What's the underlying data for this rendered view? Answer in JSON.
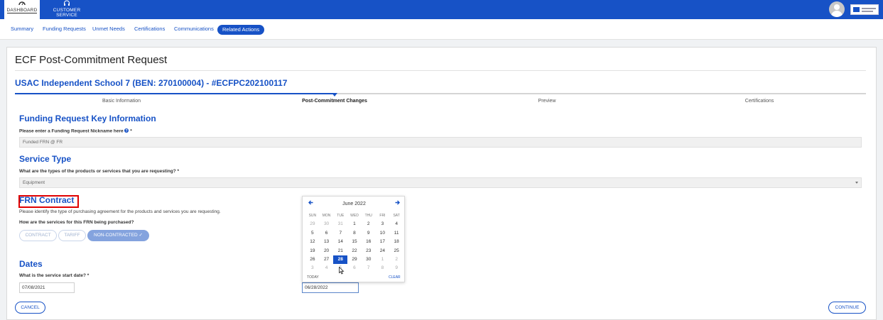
{
  "topnav": {
    "items": [
      {
        "label": "DASHBOARD",
        "icon": "dashboard-icon",
        "active": true
      },
      {
        "label": "CUSTOMER SERVICE",
        "icon": "headset-icon",
        "active": false
      }
    ]
  },
  "subnav": {
    "tabs": [
      "Summary",
      "Funding Requests",
      "Unmet Needs",
      "Certifications",
      "Communications"
    ],
    "active_tab": "Related Actions"
  },
  "page": {
    "title": "ECF Post-Commitment Request",
    "subtitle": "USAC Independent School 7 (BEN: 270100004) - #ECFPC202100117"
  },
  "stepper": {
    "steps": [
      "Basic Information",
      "Post-Commitment Changes",
      "Preview",
      "Certifications"
    ],
    "current_index": 1
  },
  "funding_request": {
    "heading": "Funding Request Key Information",
    "label": "Please enter a Funding Request Nickname here",
    "help_icon": "question-circle-icon",
    "required": "*",
    "value": "Funded FRN @ FR"
  },
  "service_type": {
    "heading": "Service Type",
    "label": "What are the types of the products or services that you are requesting? *",
    "value": "Equipment"
  },
  "frn_contract": {
    "heading": "FRN Contract",
    "description": "Please identify the type of purchasing agreement for the products and services you are requesting.",
    "label": "How are the services for this FRN being purchased?",
    "options": [
      "CONTRACT",
      "TARIFF",
      "NON-CONTRACTED ✓"
    ],
    "selected": "NON-CONTRACTED ✓"
  },
  "dates": {
    "heading": "Dates",
    "label": "What is the service start date? *",
    "start_date": "07/08/2021",
    "picker_value": "06/28/2022"
  },
  "calendar": {
    "month": "June 2022",
    "prev_icon": "arrow-left-icon",
    "next_icon": "arrow-right-icon",
    "weekdays": [
      "SUN",
      "MON",
      "TUE",
      "WED",
      "THU",
      "FRI",
      "SAT"
    ],
    "weeks": [
      [
        "29",
        "30",
        "31",
        "1",
        "2",
        "3",
        "4"
      ],
      [
        "5",
        "6",
        "7",
        "8",
        "9",
        "10",
        "11"
      ],
      [
        "12",
        "13",
        "14",
        "15",
        "16",
        "17",
        "18"
      ],
      [
        "19",
        "20",
        "21",
        "22",
        "23",
        "24",
        "25"
      ],
      [
        "26",
        "27",
        "28",
        "29",
        "30",
        "1",
        "2"
      ],
      [
        "3",
        "4",
        "5",
        "6",
        "7",
        "8",
        "9"
      ]
    ],
    "selected_day": "28",
    "today_label": "TODAY",
    "clear_label": "CLEAR"
  },
  "actions": {
    "cancel": "CANCEL",
    "continue": "CONTINUE"
  },
  "colors": {
    "primary": "#1752c6",
    "highlight": "#e00000",
    "selected_option": "#84a3de"
  }
}
